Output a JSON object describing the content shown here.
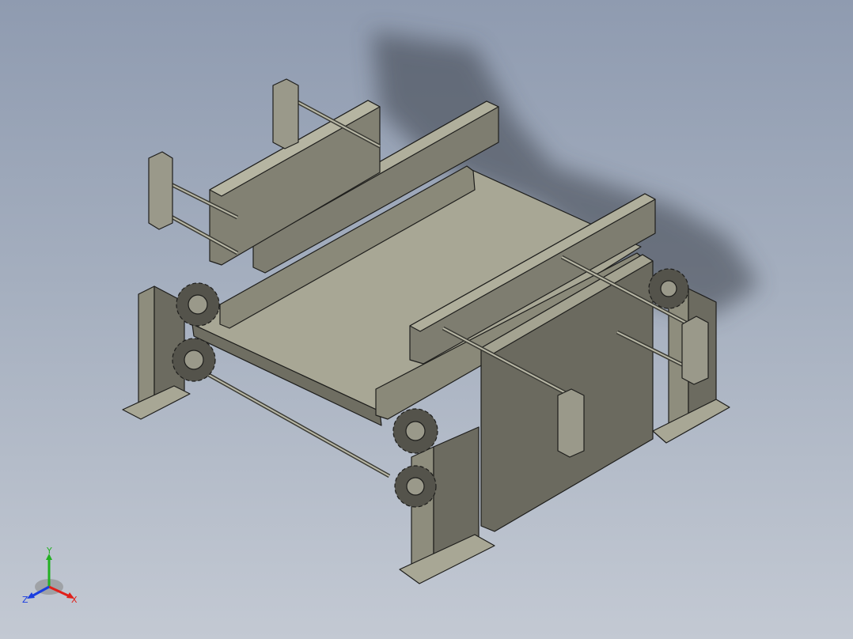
{
  "triad": {
    "x_label": "X",
    "y_label": "Y",
    "z_label": "Z"
  },
  "colors": {
    "background_top": "#8f9bb0",
    "background_bottom": "#c3c9d3",
    "metal_light": "#a9a896",
    "metal_mid": "#8e8d7d",
    "metal_dark": "#5e5d54",
    "edge": "#1e1e1c",
    "axis_x": "#e0201a",
    "axis_y": "#22b022",
    "axis_z": "#1a3ee0"
  },
  "icons": [
    "coordinate-triad-icon"
  ]
}
